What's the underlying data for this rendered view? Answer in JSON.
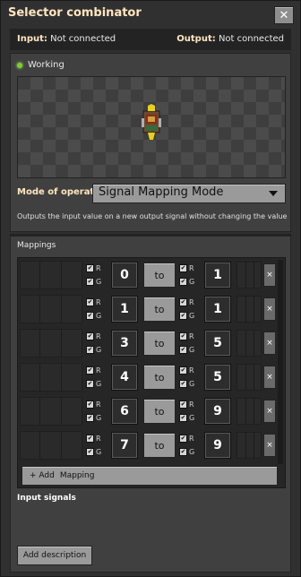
{
  "window": {
    "title": "Selector combinator",
    "close_icon": "✕"
  },
  "io": {
    "input_label": "Input:",
    "input_value": "Not connected",
    "output_label": "Output:",
    "output_value": "Not connected"
  },
  "status": {
    "text": "Working",
    "color": "#7ecf2b"
  },
  "mode": {
    "label": "Mode of operation",
    "selected": "Signal Mapping Mode",
    "description": "Outputs the input value on a new output signal without changing the value"
  },
  "mappings": {
    "label": "Mappings",
    "rows": [
      {
        "from": "0",
        "to_label": "to",
        "to": "1"
      },
      {
        "from": "1",
        "to_label": "to",
        "to": "1"
      },
      {
        "from": "3",
        "to_label": "to",
        "to": "5"
      },
      {
        "from": "4",
        "to_label": "to",
        "to": "5"
      },
      {
        "from": "6",
        "to_label": "to",
        "to": "9"
      },
      {
        "from": "7",
        "to_label": "to",
        "to": "9"
      }
    ],
    "wire_r": "R",
    "wire_g": "G",
    "check": "✔",
    "delete": "×",
    "add_prefix": "+ Add",
    "add_label": "Mapping"
  },
  "input_signals_label": "Input signals",
  "add_description_label": "Add description"
}
